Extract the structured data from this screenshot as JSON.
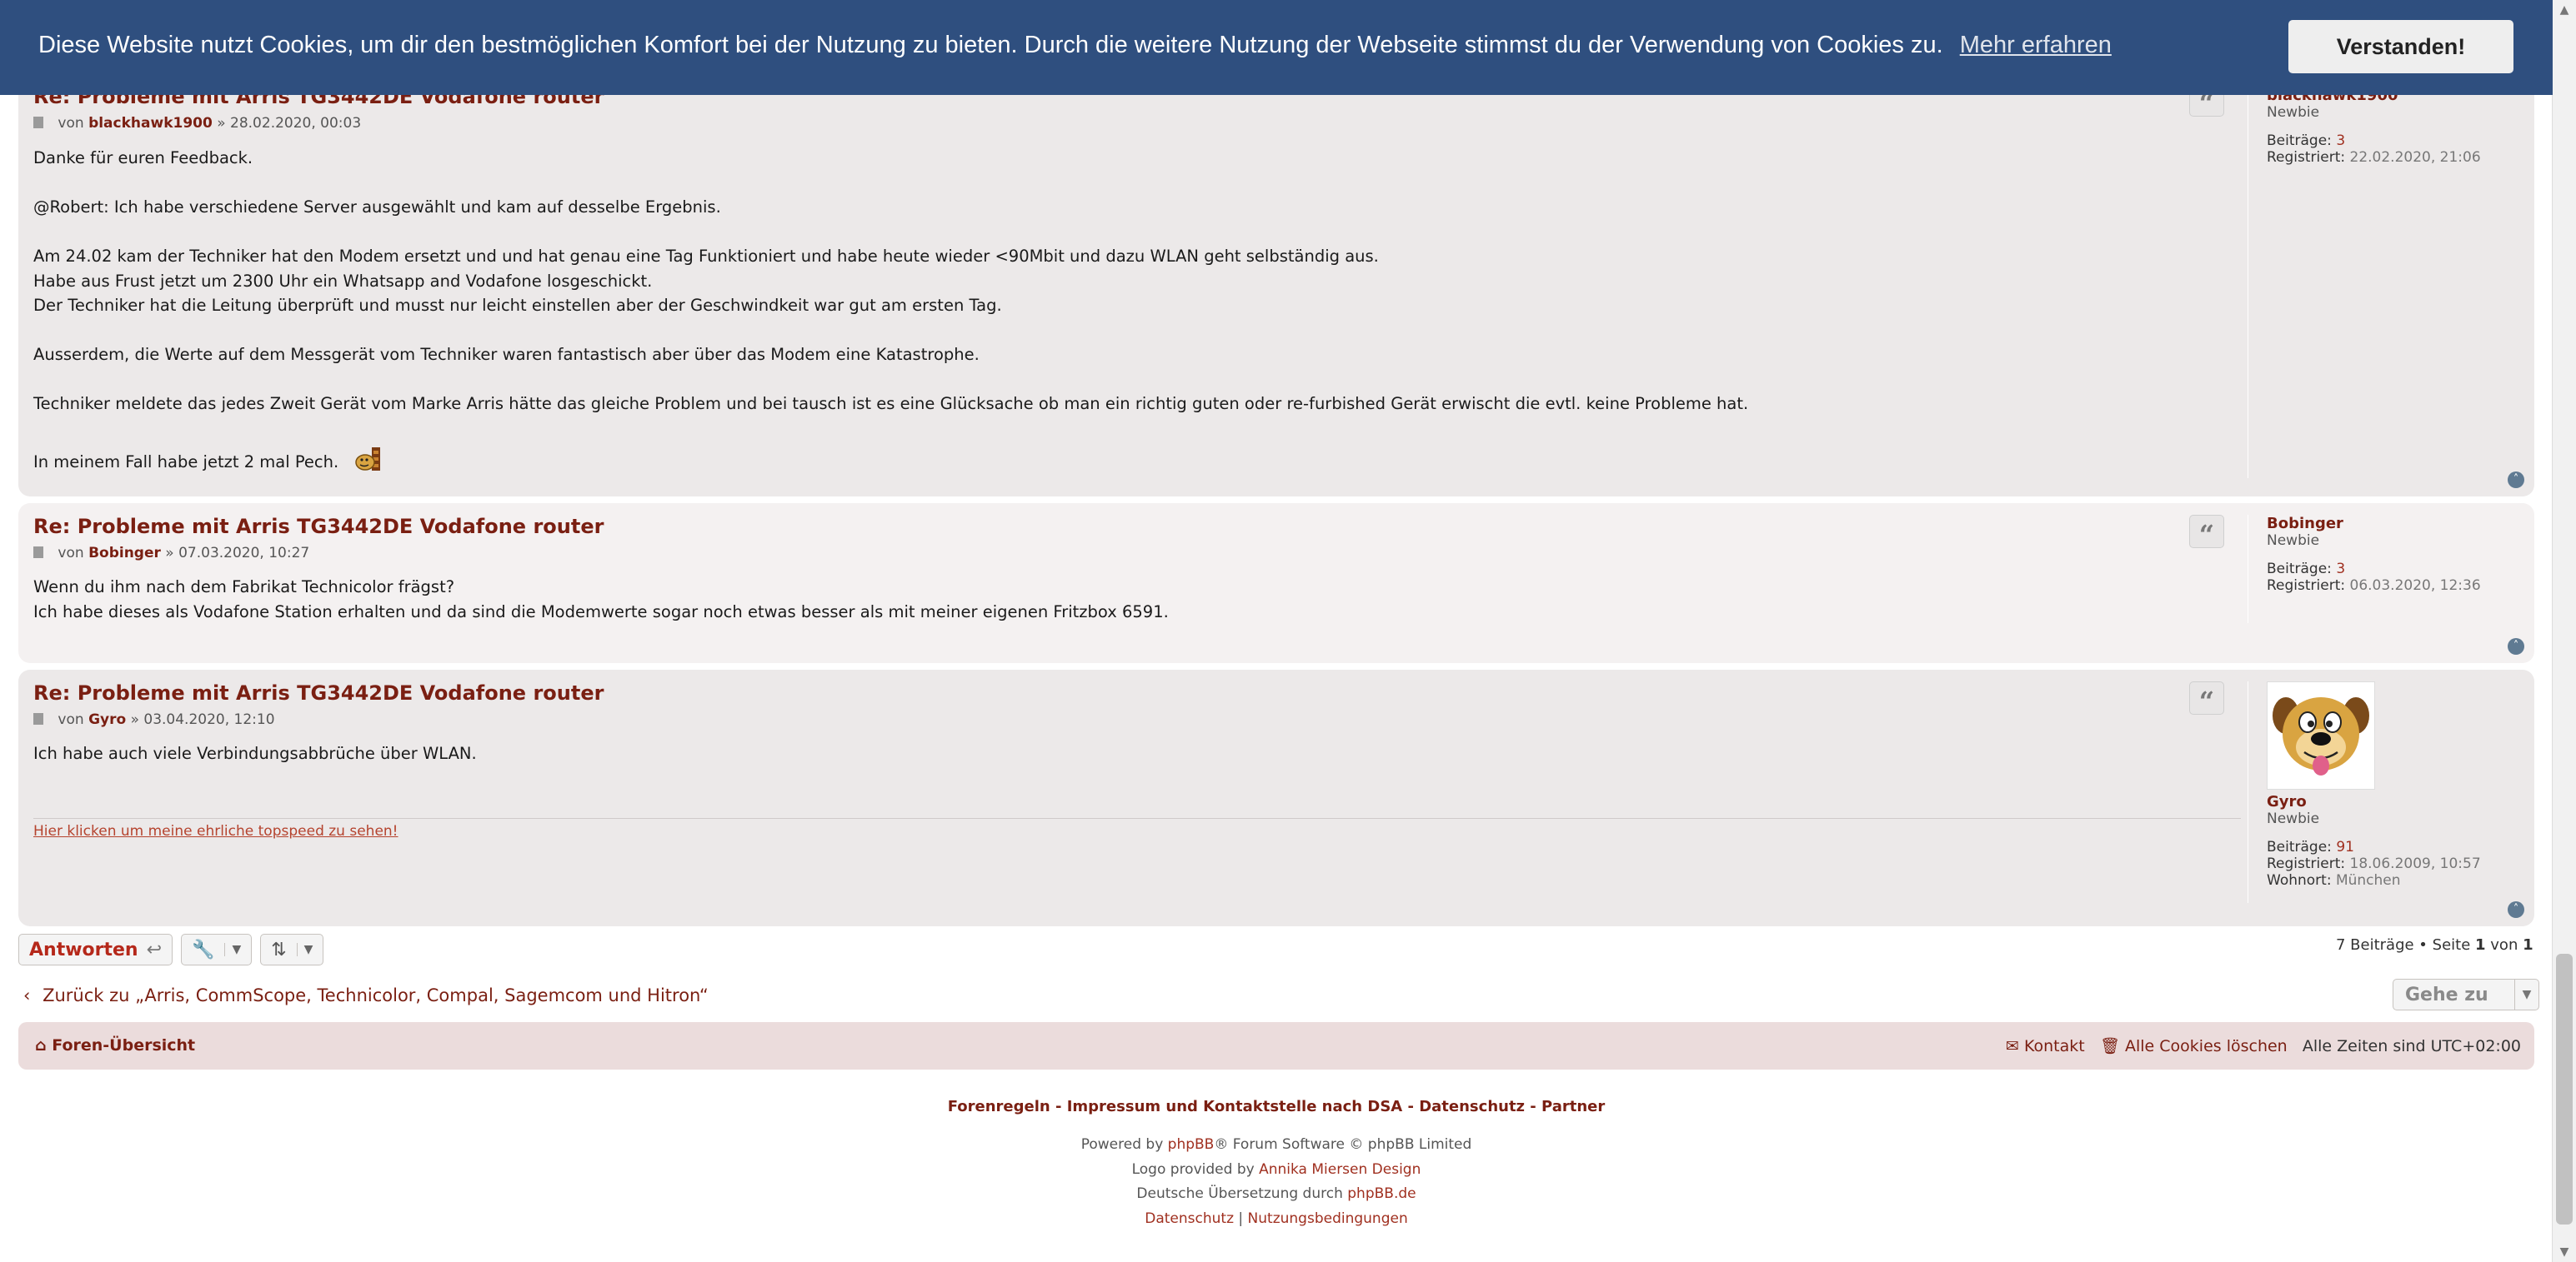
{
  "cookie_banner": {
    "message": "Diese Website nutzt Cookies, um dir den bestmöglichen Komfort bei der Nutzung zu bieten. Durch die weitere Nutzung der Webseite stimmst du der Verwendung von Cookies zu.",
    "more_link": "Mehr erfahren",
    "accept_button": "Verstanden!"
  },
  "posts": [
    {
      "title": "Re: Probleme mit Arris TG3442DE Vodafone router",
      "by": "von",
      "author": "blackhawk1900",
      "date": "» 28.02.2020, 00:03",
      "lines": [
        "Danke für euren Feedback.",
        "",
        "@Robert: Ich habe verschiedene Server ausgewählt und kam auf desselbe Ergebnis.",
        "",
        "Am 24.02 kam der Techniker hat den Modem ersetzt und und hat genau eine Tag Funktioniert und habe heute wieder <90Mbit und dazu WLAN geht selbständig aus.",
        "Habe aus Frust jetzt um 2300 Uhr ein Whatsapp and Vodafone losgeschickt.",
        "Der Techniker hat die Leitung überprüft und musst nur leicht einstellen aber der Geschwindkeit war gut am ersten Tag.",
        "",
        "Ausserdem, die Werte auf dem Messgerät vom Techniker waren fantastisch aber über das Modem eine Katastrophe.",
        "",
        "Techniker meldete das jedes Zweit Gerät vom Marke Arris hätte das gleiche Problem und bei tausch ist es eine Glücksache ob man ein richtig guten oder re-furbished Gerät erwischt die evtl. keine Probleme hat.",
        ""
      ],
      "last_line": "In meinem Fall habe jetzt 2 mal Pech.",
      "profile": {
        "username": "blackhawk1900",
        "rank": "Newbie",
        "posts_label": "Beiträge:",
        "posts_value": "3",
        "registered_label": "Registriert:",
        "registered_value": "22.02.2020, 21:06"
      }
    },
    {
      "title": "Re: Probleme mit Arris TG3442DE Vodafone router",
      "by": "von",
      "author": "Bobinger",
      "date": "» 07.03.2020, 10:27",
      "lines": [
        "Wenn du ihm nach dem Fabrikat Technicolor frägst?",
        "Ich habe dieses als Vodafone Station erhalten und da sind die Modemwerte sogar noch etwas besser als mit meiner eigenen Fritzbox 6591."
      ],
      "profile": {
        "username": "Bobinger",
        "rank": "Newbie",
        "posts_label": "Beiträge:",
        "posts_value": "3",
        "registered_label": "Registriert:",
        "registered_value": "06.03.2020, 12:36"
      }
    },
    {
      "title": "Re: Probleme mit Arris TG3442DE Vodafone router",
      "by": "von",
      "author": "Gyro",
      "date": "» 03.04.2020, 12:10",
      "lines": [
        "Ich habe auch viele Verbindungsabbrüche über WLAN."
      ],
      "signature": "Hier klicken um meine ehrliche topspeed zu sehen!",
      "profile": {
        "username": "Gyro",
        "rank": "Newbie",
        "posts_label": "Beiträge:",
        "posts_value": "91",
        "registered_label": "Registriert:",
        "registered_value": "18.06.2009, 10:57",
        "location_label": "Wohnort:",
        "location_value": "München"
      }
    }
  ],
  "toolbar": {
    "reply_label": "Antworten",
    "pagination": {
      "count": "7 Beiträge • Seite",
      "page": "1",
      "of": "von",
      "total": "1"
    }
  },
  "nav": {
    "back_link": "Zurück zu „Arris, CommScope, Technicolor, Compal, Sagemcom und Hitron“",
    "jump_label": "Gehe zu"
  },
  "footer_nav": {
    "home": "Foren-Übersicht",
    "contact": "Kontakt",
    "delete_cookies": "Alle Cookies löschen",
    "timezone": "Alle Zeiten sind UTC+02:00"
  },
  "footer_links": {
    "text": "Forenregeln - Impressum und Kontaktstelle nach DSA - Datenschutz - Partner"
  },
  "copyright": {
    "powered_pre": "Powered by",
    "phpbb": "phpBB",
    "powered_post": "® Forum Software © phpBB Limited",
    "logo_pre": "Logo provided by",
    "logo_author": "Annika Miersen Design",
    "translation_pre": "Deutsche Übersetzung durch",
    "translation_link": "phpBB.de",
    "privacy": "Datenschutz",
    "sep": "|",
    "terms": "Nutzungsbedingungen"
  },
  "colors": {
    "cookie_bar": "#2f4f7f",
    "link": "#7a1f12",
    "post_bg_alt": "#ece9e9",
    "post_bg": "#f4f1f1",
    "footer_nav_bg": "#ebdcdc"
  },
  "icons": [
    "file-icon",
    "quote-icon",
    "back-to-top-icon",
    "reply-arrow-icon",
    "wrench-icon",
    "sort-icon",
    "home-icon",
    "envelope-icon",
    "trash-icon",
    "chevron-left-icon",
    "smiley-icon"
  ]
}
